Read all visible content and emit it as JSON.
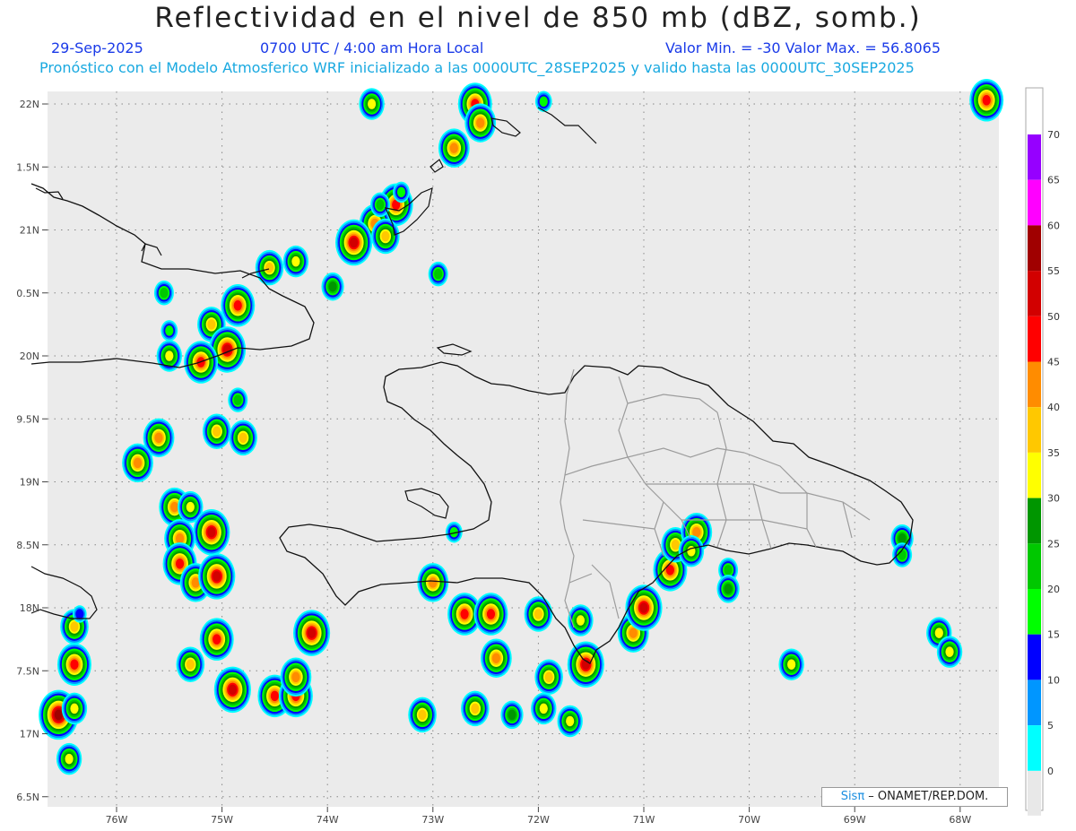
{
  "title": "Reflectividad en el nivel de 850 mb (dBZ, somb.)",
  "header": {
    "date": "29-Sep-2025",
    "time": "0700 UTC / 4:00 am Hora Local",
    "minmax": "Valor Min. = -30  Valor Max. = 56.8065",
    "subtitle": "Pronóstico con el Modelo Atmosferico WRF inicializado a las 0000UTC_28SEP2025 y valido hasta las  0000UTC_30SEP2025"
  },
  "credit": {
    "brand": "Sisπ",
    "text": " – ONAMET/REP.DOM."
  },
  "map": {
    "lat_labels": [
      "22N",
      "1.5N",
      "21N",
      "0.5N",
      "20N",
      "9.5N",
      "19N",
      "8.5N",
      "18N",
      "7.5N",
      "17N",
      "6.5N"
    ],
    "lon_labels": [
      "76W",
      "75W",
      "74W",
      "73W",
      "72W",
      "71W",
      "70W",
      "69W",
      "68W"
    ],
    "grid_lines": true,
    "background": "#ebebeb"
  },
  "colorbar": {
    "labels": [
      "0",
      "5",
      "10",
      "15",
      "20",
      "25",
      "30",
      "35",
      "40",
      "45",
      "50",
      "55",
      "60",
      "65",
      "70"
    ],
    "colors": [
      "#00ffff",
      "#0096ff",
      "#0000ff",
      "#00ff00",
      "#00c800",
      "#009600",
      "#ffff00",
      "#ffc800",
      "#ff8c00",
      "#ff0000",
      "#d20000",
      "#a00000",
      "#ff00ff",
      "#9600ff",
      "#ffffff"
    ]
  },
  "cells": [
    {
      "lon": -73.58,
      "lat": 22.0,
      "dbz": 30
    },
    {
      "lon": -72.6,
      "lat": 22.0,
      "dbz": 45
    },
    {
      "lon": -72.55,
      "lat": 21.85,
      "dbz": 40
    },
    {
      "lon": -72.8,
      "lat": 21.65,
      "dbz": 40
    },
    {
      "lon": -71.95,
      "lat": 22.02,
      "dbz": 15
    },
    {
      "lon": -67.75,
      "lat": 22.03,
      "dbz": 45
    },
    {
      "lon": -73.35,
      "lat": 21.2,
      "dbz": 45
    },
    {
      "lon": -73.55,
      "lat": 21.05,
      "dbz": 40
    },
    {
      "lon": -73.75,
      "lat": 20.9,
      "dbz": 50
    },
    {
      "lon": -73.45,
      "lat": 20.95,
      "dbz": 35
    },
    {
      "lon": -73.95,
      "lat": 20.55,
      "dbz": 25
    },
    {
      "lon": -74.3,
      "lat": 20.75,
      "dbz": 30
    },
    {
      "lon": -74.55,
      "lat": 20.7,
      "dbz": 35
    },
    {
      "lon": -74.85,
      "lat": 20.4,
      "dbz": 45
    },
    {
      "lon": -75.1,
      "lat": 20.25,
      "dbz": 35
    },
    {
      "lon": -74.95,
      "lat": 20.05,
      "dbz": 50
    },
    {
      "lon": -75.2,
      "lat": 19.95,
      "dbz": 45
    },
    {
      "lon": -75.5,
      "lat": 20.0,
      "dbz": 30
    },
    {
      "lon": -75.5,
      "lat": 20.2,
      "dbz": 15
    },
    {
      "lon": -74.85,
      "lat": 19.65,
      "dbz": 20
    },
    {
      "lon": -75.05,
      "lat": 19.4,
      "dbz": 35
    },
    {
      "lon": -74.8,
      "lat": 19.35,
      "dbz": 35
    },
    {
      "lon": -75.6,
      "lat": 19.35,
      "dbz": 40
    },
    {
      "lon": -75.8,
      "lat": 19.15,
      "dbz": 40
    },
    {
      "lon": -75.45,
      "lat": 18.8,
      "dbz": 40
    },
    {
      "lon": -75.3,
      "lat": 18.8,
      "dbz": 30
    },
    {
      "lon": -75.1,
      "lat": 18.6,
      "dbz": 50
    },
    {
      "lon": -75.4,
      "lat": 18.55,
      "dbz": 40
    },
    {
      "lon": -75.4,
      "lat": 18.35,
      "dbz": 45
    },
    {
      "lon": -75.25,
      "lat": 18.2,
      "dbz": 40
    },
    {
      "lon": -75.05,
      "lat": 18.25,
      "dbz": 50
    },
    {
      "lon": -75.05,
      "lat": 17.75,
      "dbz": 45
    },
    {
      "lon": -75.3,
      "lat": 17.55,
      "dbz": 35
    },
    {
      "lon": -76.4,
      "lat": 17.55,
      "dbz": 45
    },
    {
      "lon": -76.4,
      "lat": 17.85,
      "dbz": 35
    },
    {
      "lon": -76.55,
      "lat": 17.15,
      "dbz": 55
    },
    {
      "lon": -76.4,
      "lat": 17.2,
      "dbz": 30
    },
    {
      "lon": -76.45,
      "lat": 16.8,
      "dbz": 30
    },
    {
      "lon": -74.15,
      "lat": 17.8,
      "dbz": 50
    },
    {
      "lon": -74.9,
      "lat": 17.35,
      "dbz": 50
    },
    {
      "lon": -74.5,
      "lat": 17.3,
      "dbz": 45
    },
    {
      "lon": -74.3,
      "lat": 17.3,
      "dbz": 45
    },
    {
      "lon": -74.3,
      "lat": 17.45,
      "dbz": 40
    },
    {
      "lon": -73.0,
      "lat": 18.2,
      "dbz": 40
    },
    {
      "lon": -72.7,
      "lat": 17.95,
      "dbz": 45
    },
    {
      "lon": -72.45,
      "lat": 17.95,
      "dbz": 45
    },
    {
      "lon": -72.4,
      "lat": 17.6,
      "dbz": 40
    },
    {
      "lon": -72.0,
      "lat": 17.95,
      "dbz": 35
    },
    {
      "lon": -71.9,
      "lat": 17.45,
      "dbz": 35
    },
    {
      "lon": -71.55,
      "lat": 17.55,
      "dbz": 50
    },
    {
      "lon": -71.6,
      "lat": 17.9,
      "dbz": 30
    },
    {
      "lon": -71.1,
      "lat": 17.8,
      "dbz": 40
    },
    {
      "lon": -71.0,
      "lat": 18.0,
      "dbz": 50
    },
    {
      "lon": -70.75,
      "lat": 18.3,
      "dbz": 45
    },
    {
      "lon": -70.7,
      "lat": 18.5,
      "dbz": 35
    },
    {
      "lon": -70.5,
      "lat": 18.6,
      "dbz": 40
    },
    {
      "lon": -70.55,
      "lat": 18.45,
      "dbz": 30
    },
    {
      "lon": -70.2,
      "lat": 18.3,
      "dbz": 20
    },
    {
      "lon": -70.2,
      "lat": 18.15,
      "dbz": 25
    },
    {
      "lon": -69.6,
      "lat": 17.55,
      "dbz": 30
    },
    {
      "lon": -68.55,
      "lat": 18.55,
      "dbz": 25
    },
    {
      "lon": -68.55,
      "lat": 18.42,
      "dbz": 20
    },
    {
      "lon": -68.2,
      "lat": 17.8,
      "dbz": 30
    },
    {
      "lon": -68.1,
      "lat": 17.65,
      "dbz": 30
    },
    {
      "lon": -72.6,
      "lat": 17.2,
      "dbz": 35
    },
    {
      "lon": -73.1,
      "lat": 17.15,
      "dbz": 35
    },
    {
      "lon": -72.25,
      "lat": 17.15,
      "dbz": 25
    },
    {
      "lon": -71.95,
      "lat": 17.2,
      "dbz": 30
    },
    {
      "lon": -71.7,
      "lat": 17.1,
      "dbz": 30
    },
    {
      "lon": -73.3,
      "lat": 21.3,
      "dbz": 15
    },
    {
      "lon": -73.5,
      "lat": 21.2,
      "dbz": 20
    },
    {
      "lon": -72.95,
      "lat": 20.65,
      "dbz": 20
    },
    {
      "lon": -75.55,
      "lat": 20.5,
      "dbz": 20
    },
    {
      "lon": -76.35,
      "lat": 17.95,
      "dbz": 10
    },
    {
      "lon": -72.8,
      "lat": 18.6,
      "dbz": 15
    }
  ]
}
